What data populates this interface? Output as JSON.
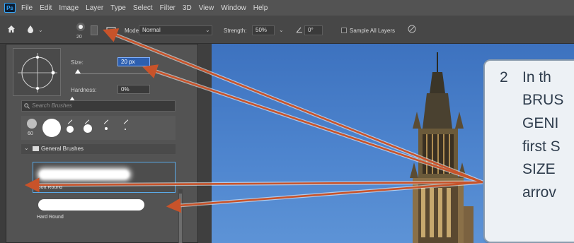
{
  "menubar": {
    "logo": "Ps",
    "items": [
      "File",
      "Edit",
      "Image",
      "Layer",
      "Type",
      "Select",
      "Filter",
      "3D",
      "View",
      "Window",
      "Help"
    ]
  },
  "options_bar": {
    "brush_size": "20",
    "mode_label": "Mode:",
    "mode_value": "Normal",
    "strength_label": "Strength:",
    "strength_value": "50%",
    "angle_value": "0°",
    "sample_all_layers": "Sample All Layers"
  },
  "brush_picker": {
    "size_label": "Size:",
    "size_value": "20 px",
    "size_fraction": 0.04,
    "hardness_label": "Hardness:",
    "hardness_value": "0%",
    "hardness_fraction": 0.0,
    "search_placeholder": "Search Brushes",
    "recent_first_label": "60",
    "group_label": "General Brushes",
    "brushes": [
      {
        "name": "Soft Round",
        "selected": true
      },
      {
        "name": "Hard Round",
        "selected": false
      }
    ]
  },
  "callout": {
    "number": "2",
    "lines": [
      "In th",
      "BRUS",
      "GENI",
      "first S",
      "SIZE",
      "arrov"
    ]
  },
  "colors": {
    "menubar": "#535353",
    "panel": "#535353",
    "selection": "#5aa9e6",
    "arrow": "#c8532a",
    "sky": "#4f86cf"
  }
}
